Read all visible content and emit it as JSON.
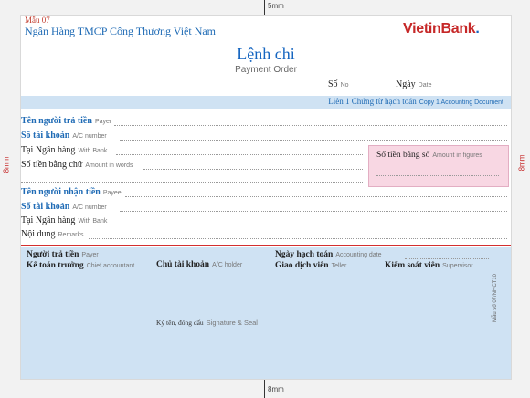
{
  "dims": {
    "top": "5mm",
    "bottom": "8mm",
    "left": "8mm",
    "right": "8mm"
  },
  "header": {
    "form_code": "Mẫu 07",
    "bank_name": "Ngân Hàng TMCP Công Thương Việt Nam",
    "logo_text": "VietinBank",
    "logo_mark": "."
  },
  "title": {
    "vn": "Lệnh chi",
    "en": "Payment Order"
  },
  "number_row": {
    "so_label": "Số",
    "so_sub": "No",
    "ngay_label": "Ngày",
    "ngay_sub": "Date"
  },
  "copy_band": {
    "vn": "Liên 1 Chứng từ hạch toán",
    "en": "Copy 1 Accounting Document"
  },
  "payer": {
    "name_label": "Tên người trả tiền",
    "name_sub": "Payer",
    "account_label": "Số tài khoản",
    "account_sub": "A/C number",
    "bank_label": "Tại Ngân hàng",
    "bank_sub": "With Bank",
    "words_label": "Số tiền bằng chữ",
    "words_sub": "Amount in words"
  },
  "amount_box": {
    "label": "Số tiền bằng số",
    "sub": "Amount in figures"
  },
  "payee": {
    "name_label": "Tên người nhận tiền",
    "name_sub": "Payee",
    "account_label": "Số tài khoản",
    "account_sub": "A/C number",
    "bank_label": "Tại Ngân hàng",
    "bank_sub": "With Bank",
    "remarks_label": "Nội dung",
    "remarks_sub": "Remarks"
  },
  "signatures": {
    "payer_label": "Người trả tiền",
    "payer_sub": "Payer",
    "chief_label": "Kế toán trưởng",
    "chief_sub": "Chief accountant",
    "holder_label": "Chủ tài khoản",
    "holder_sub": "A/C holder",
    "accdate_label": "Ngày hạch toán",
    "accdate_sub": "Accounting date",
    "teller_label": "Giao dịch viên",
    "teller_sub": "Teller",
    "supervisor_label": "Kiểm soát viên",
    "supervisor_sub": "Supervisor",
    "seal_label": "Ký tên, đóng dấu",
    "seal_sub": "Signature & Seal"
  },
  "side_code": "Mẫu số 07/NHCT10"
}
